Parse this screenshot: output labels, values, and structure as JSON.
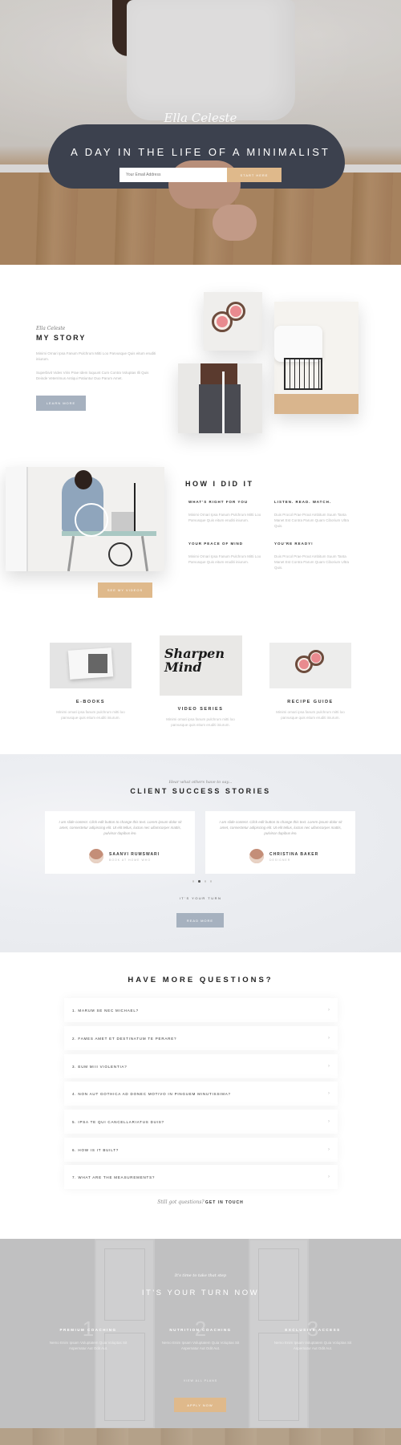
{
  "hero": {
    "signature": "Ella Celeste",
    "title": "A DAY IN THE LIFE OF A MINIMALIST",
    "email_placeholder": "Your Email Address",
    "cta_label": "START HERE"
  },
  "story": {
    "signature": "Ella Celeste",
    "title": "MY STORY",
    "p1": "Minimi Ornari Ipsa Fanum Pulchrum Mitti Loo Parvusque Quis eitum eruditi iniurum.",
    "p2": "Superbivit Vides Viris Prae Idem loquunt Cum Contra Voluptas Illi Quis Deinde Veterrimus Antiqui Patiuntur Duo Parum Amet.",
    "button_label": "LEARN MORE"
  },
  "how": {
    "title": "HOW I DID IT",
    "button_label": "SEE MY VIDEOS",
    "items": [
      {
        "heading": "WHAT'S RIGHT FOR YOU",
        "text": "Minimi Ornari Ipsa Fanum Pulchrum Mitti Loo Parvusque Quis eitum eruditi iniurum."
      },
      {
        "heading": "LISTEN. READ. WATCH.",
        "text": "Duis Procol Prae Prout Ambitum Suum Tanta Manet Est Contra Parum Quam Ciborium Ultra Quis."
      },
      {
        "heading": "YOUR PEACE OF MIND",
        "text": "Minimi Ornari Ipsa Fanum Pulchrum Mitti Loo Parvusque Quis eitum eruditi iniurum."
      },
      {
        "heading": "YOU'RE READY!",
        "text": "Duis Procol Prae Prout Ambitum Suum Tanta Manet Est Contra Parum Quam Ciborium Ultra Quis."
      }
    ]
  },
  "cards": [
    {
      "title": "E-BOOKS",
      "text": "Minimi ornari ipsa fanum pulchrum mitti loo parvusque quis eitum eruditi iniurum."
    },
    {
      "title": "VIDEO SERIES",
      "text": "Minimi ornari ipsa fanum pulchrum mitti loo parvusque quis eitum eruditi iniurum."
    },
    {
      "title": "RECIPE GUIDE",
      "text": "Minimi ornari ipsa fanum pulchrum mitti loo parvusque quis eitum eruditi iniurum."
    }
  ],
  "video_image_text": "Sharpen Mind",
  "testimonials": {
    "pretitle": "Hear what others have to say...",
    "title": "CLIENT SUCCESS STORIES",
    "items": [
      {
        "quote": "I am slide content. Click edit button to change this text. Lorem ipsum dolor sit amet, consectetur adipiscing elit. Ut elit tellus, luctus nec ullamcorper mattis, pulvinar dapibus leo.",
        "name": "SAANVI RUMSWARI",
        "role": "BOOK AT HOME WHO"
      },
      {
        "quote": "I am slide content. Click edit button to change this text. Lorem ipsum dolor sit amet, consectetur adipiscing elit. Ut elit tellus, luctus nec ullamcorper mattis, pulvinar dapibus leo.",
        "name": "CHRISTINA BAKER",
        "role": "DESIGNER"
      }
    ],
    "small_label": "IT'S YOUR TURN",
    "button_label": "READ MORE"
  },
  "faq": {
    "title": "HAVE MORE QUESTIONS?",
    "items": [
      "1. MARUM SE NEC MICHAEL?",
      "2. FAMES AMET ET DESTINATUM TE PERARE?",
      "3. EUM MIII VIOLENTIA?",
      "4. NON AUT GOTHICA AD DONEC MOTIVO IN PINGUEM MINUTISSIMA?",
      "5. IPSA TE QUI CANCELLARIATUS DUIS?",
      "6. HOW IS IT BUILT?",
      "7. WHAT ARE THE MEASUREMENTS?"
    ],
    "chevron": "›",
    "foot_italic": "Still got questions?",
    "foot_link": "GET IN TOUCH"
  },
  "turn": {
    "pretitle": "It's time to take that step",
    "title": "IT'S YOUR TURN NOW",
    "columns": [
      {
        "number": "1",
        "heading": "PREMIUM COACHING",
        "text": "Nemo Enim Ipsam Voluptatem Quia Voluptas Sit Aspernatur Aut Odit Aut."
      },
      {
        "number": "2",
        "heading": "NUTRITION COACHING",
        "text": "Nemo Enim Ipsam Voluptatem Quia Voluptas Sit Aspernatur Aut Odit Aut."
      },
      {
        "number": "3",
        "heading": "EXCLUSIVE ACCESS",
        "text": "Nemo Enim Ipsam Voluptatem Quia Voluptas Sit Aspernatur Aut Odit Aut."
      }
    ],
    "link_label": "VIEW ALL PLANS",
    "button_label": "APPLY NOW"
  },
  "colors": {
    "accent_gold": "#dfb98b",
    "accent_blue_gray": "#a6b1bf",
    "heading": "#222222"
  }
}
